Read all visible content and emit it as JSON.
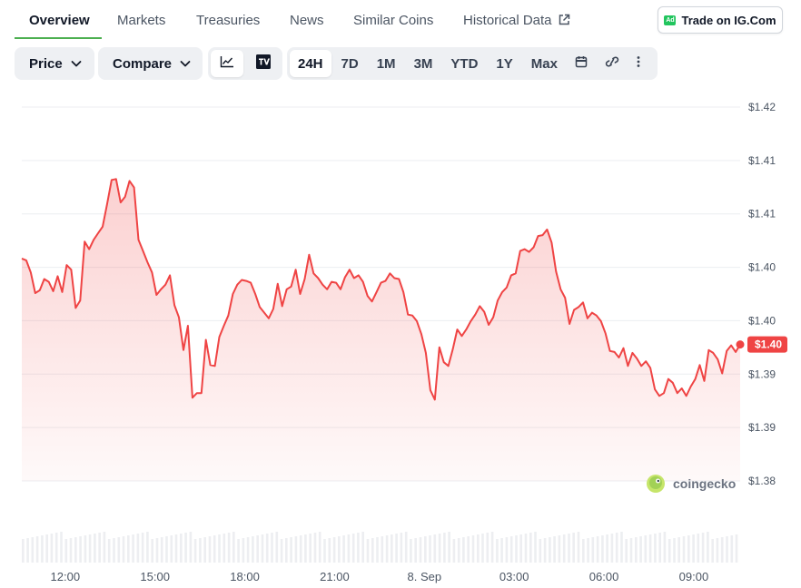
{
  "tabs": [
    {
      "label": "Overview",
      "active": true
    },
    {
      "label": "Markets",
      "active": false
    },
    {
      "label": "Treasuries",
      "active": false
    },
    {
      "label": "News",
      "active": false
    },
    {
      "label": "Similar Coins",
      "active": false
    },
    {
      "label": "Historical Data",
      "active": false,
      "external": true
    }
  ],
  "ad": {
    "badge": "Ad",
    "label": "Trade on IG.Com"
  },
  "toolbar": {
    "price_label": "Price",
    "compare_label": "Compare",
    "chart_types": [
      {
        "icon": "line-chart-icon",
        "active": true
      },
      {
        "icon": "tradingview-icon",
        "active": false
      }
    ],
    "ranges": [
      {
        "label": "24H",
        "active": true
      },
      {
        "label": "7D",
        "active": false
      },
      {
        "label": "1M",
        "active": false
      },
      {
        "label": "3M",
        "active": false
      },
      {
        "label": "YTD",
        "active": false
      },
      {
        "label": "1Y",
        "active": false
      },
      {
        "label": "Max",
        "active": false
      }
    ],
    "extra_icons": [
      "calendar-icon",
      "link-icon",
      "more-vertical-icon"
    ]
  },
  "watermark": "coingecko",
  "chart_data": {
    "type": "area",
    "title": "",
    "xlabel": "",
    "ylabel": "",
    "color": "#ef4444",
    "y_tick_labels": [
      "$1.42",
      "$1.41",
      "$1.41",
      "$1.40",
      "$1.40",
      "$1.39",
      "$1.39",
      "$1.38"
    ],
    "ylim": [
      1.38,
      1.42
    ],
    "x_tick_labels": [
      "12:00",
      "15:00",
      "18:00",
      "21:00",
      "8. Sep",
      "03:00",
      "06:00",
      "09:00"
    ],
    "x_tick_hours": [
      1.45,
      4.45,
      7.45,
      10.45,
      13.45,
      16.45,
      19.45,
      22.45
    ],
    "xlim": [
      0,
      24
    ],
    "grid": true,
    "current_price_label": "$1.40",
    "series": [
      {
        "values": [
          1.4038,
          1.4036,
          1.4023,
          1.4001,
          1.4004,
          1.4016,
          1.4013,
          1.4003,
          1.4019,
          1.4002,
          1.4031,
          1.4026,
          1.3985,
          1.3993,
          1.4056,
          1.4048,
          1.4058,
          1.4065,
          1.4072,
          1.4096,
          1.4122,
          1.4123,
          1.4098,
          1.4104,
          1.4121,
          1.4114,
          1.4058,
          1.4046,
          1.4034,
          1.4023,
          1.3999,
          1.4005,
          1.401,
          1.402,
          1.3988,
          1.3975,
          1.394,
          1.3966,
          1.3889,
          1.3894,
          1.3894,
          1.3951,
          1.3924,
          1.3923,
          1.3954,
          1.3966,
          1.3977,
          1.4,
          1.401,
          1.4015,
          1.4014,
          1.4012,
          1.4,
          1.3986,
          1.398,
          1.3974,
          1.3984,
          1.4011,
          1.3987,
          1.4005,
          1.4008,
          1.4026,
          1.4,
          1.4016,
          1.4042,
          1.4022,
          1.4017,
          1.401,
          1.4005,
          1.4013,
          1.4012,
          1.4005,
          1.4018,
          1.4026,
          1.4017,
          1.402,
          1.4013,
          1.3998,
          1.3992,
          1.4002,
          1.4012,
          1.4014,
          1.4022,
          1.4017,
          1.4016,
          1.4002,
          1.3978,
          1.3977,
          1.3971,
          1.3957,
          1.3937,
          1.3897,
          1.3887,
          1.3943,
          1.3927,
          1.3923,
          1.3941,
          1.3962,
          1.3955,
          1.3962,
          1.3971,
          1.3978,
          1.3987,
          1.3981,
          1.3967,
          1.3975,
          1.3993,
          1.4002,
          1.4007,
          1.402,
          1.4022,
          1.4046,
          1.4048,
          1.4045,
          1.405,
          1.4062,
          1.4063,
          1.4069,
          1.4055,
          1.4024,
          1.4005,
          1.3996,
          1.3968,
          1.3983,
          1.3986,
          1.3991,
          1.3974,
          1.398,
          1.3977,
          1.3971,
          1.3958,
          1.3939,
          1.3938,
          1.3932,
          1.3942,
          1.3923,
          1.3937,
          1.3931,
          1.3923,
          1.3928,
          1.3921,
          1.3898,
          1.3891,
          1.3894,
          1.3909,
          1.3905,
          1.3894,
          1.3899,
          1.3891,
          1.3901,
          1.3909,
          1.3924,
          1.3907,
          1.394,
          1.3937,
          1.393,
          1.3915,
          1.3939,
          1.3945,
          1.3938,
          1.3946
        ]
      }
    ],
    "volume_bars": 150
  }
}
